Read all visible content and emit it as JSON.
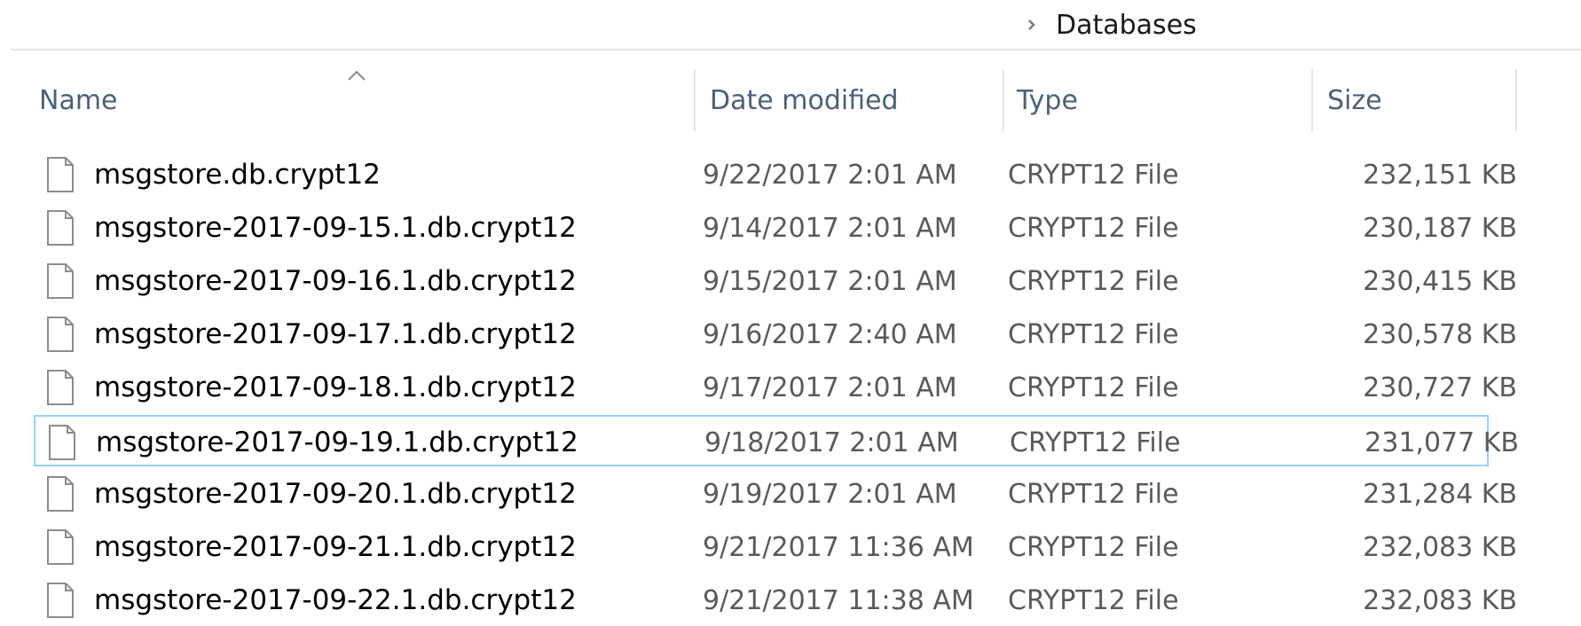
{
  "breadcrumb": {
    "chevron_icon": "chevron-right-icon",
    "current": "Databases"
  },
  "columns": {
    "name": "Name",
    "date_modified": "Date modified",
    "type": "Type",
    "size": "Size",
    "sort_icon": "sort-ascending-caret-icon"
  },
  "colors": {
    "header_text": "#4c607a",
    "selection_border": "#99d1ff",
    "secondary_text": "#5a5a5a"
  },
  "files": [
    {
      "name": "msgstore.db.crypt12",
      "date": "9/22/2017 2:01 AM",
      "type": "CRYPT12 File",
      "size": "232,151 KB",
      "icon": "generic-file-icon",
      "selected": false
    },
    {
      "name": "msgstore-2017-09-15.1.db.crypt12",
      "date": "9/14/2017 2:01 AM",
      "type": "CRYPT12 File",
      "size": "230,187 KB",
      "icon": "generic-file-icon",
      "selected": false
    },
    {
      "name": "msgstore-2017-09-16.1.db.crypt12",
      "date": "9/15/2017 2:01 AM",
      "type": "CRYPT12 File",
      "size": "230,415 KB",
      "icon": "generic-file-icon",
      "selected": false
    },
    {
      "name": "msgstore-2017-09-17.1.db.crypt12",
      "date": "9/16/2017 2:40 AM",
      "type": "CRYPT12 File",
      "size": "230,578 KB",
      "icon": "generic-file-icon",
      "selected": false
    },
    {
      "name": "msgstore-2017-09-18.1.db.crypt12",
      "date": "9/17/2017 2:01 AM",
      "type": "CRYPT12 File",
      "size": "230,727 KB",
      "icon": "generic-file-icon",
      "selected": false
    },
    {
      "name": "msgstore-2017-09-19.1.db.crypt12",
      "date": "9/18/2017 2:01 AM",
      "type": "CRYPT12 File",
      "size": "231,077 KB",
      "icon": "generic-file-icon",
      "selected": true
    },
    {
      "name": "msgstore-2017-09-20.1.db.crypt12",
      "date": "9/19/2017 2:01 AM",
      "type": "CRYPT12 File",
      "size": "231,284 KB",
      "icon": "generic-file-icon",
      "selected": false
    },
    {
      "name": "msgstore-2017-09-21.1.db.crypt12",
      "date": "9/21/2017 11:36 AM",
      "type": "CRYPT12 File",
      "size": "232,083 KB",
      "icon": "generic-file-icon",
      "selected": false
    },
    {
      "name": "msgstore-2017-09-22.1.db.crypt12",
      "date": "9/21/2017 11:38 AM",
      "type": "CRYPT12 File",
      "size": "232,083 KB",
      "icon": "generic-file-icon",
      "selected": false
    }
  ]
}
